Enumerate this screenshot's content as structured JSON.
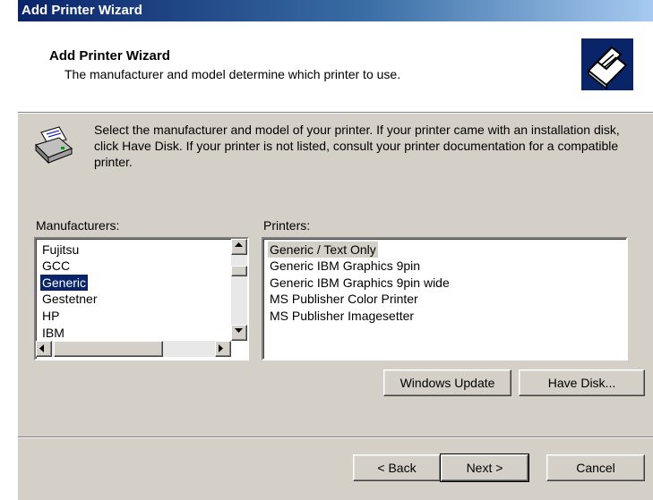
{
  "window": {
    "title": "Add Printer Wizard"
  },
  "header": {
    "title": "Add Printer Wizard",
    "subtitle": "The manufacturer and model determine which printer to use.",
    "icon": "printer-wizard-icon"
  },
  "intro": {
    "icon": "printer-icon",
    "text": "Select the manufacturer and model of your printer. If your printer came with an installation disk, click Have Disk. If your printer is not listed, consult your printer documentation for a compatible printer."
  },
  "manufacturers": {
    "label": "Manufacturers:",
    "items": [
      "Fujitsu",
      "GCC",
      "Generic",
      "Gestetner",
      "HP",
      "IBM"
    ],
    "selected": "Generic"
  },
  "printers": {
    "label": "Printers:",
    "items": [
      "Generic / Text Only",
      "Generic IBM Graphics 9pin",
      "Generic IBM Graphics 9pin wide",
      "MS Publisher Color Printer",
      "MS Publisher Imagesetter"
    ],
    "selected": "Generic / Text Only"
  },
  "buttons": {
    "windows_update": "Windows Update",
    "have_disk": "Have Disk...",
    "back": "< Back",
    "next": "Next >",
    "cancel": "Cancel"
  },
  "colors": {
    "title_bar": "#0a246a",
    "selection": "#0a246a",
    "dialog_face": "#d4d0c8"
  }
}
